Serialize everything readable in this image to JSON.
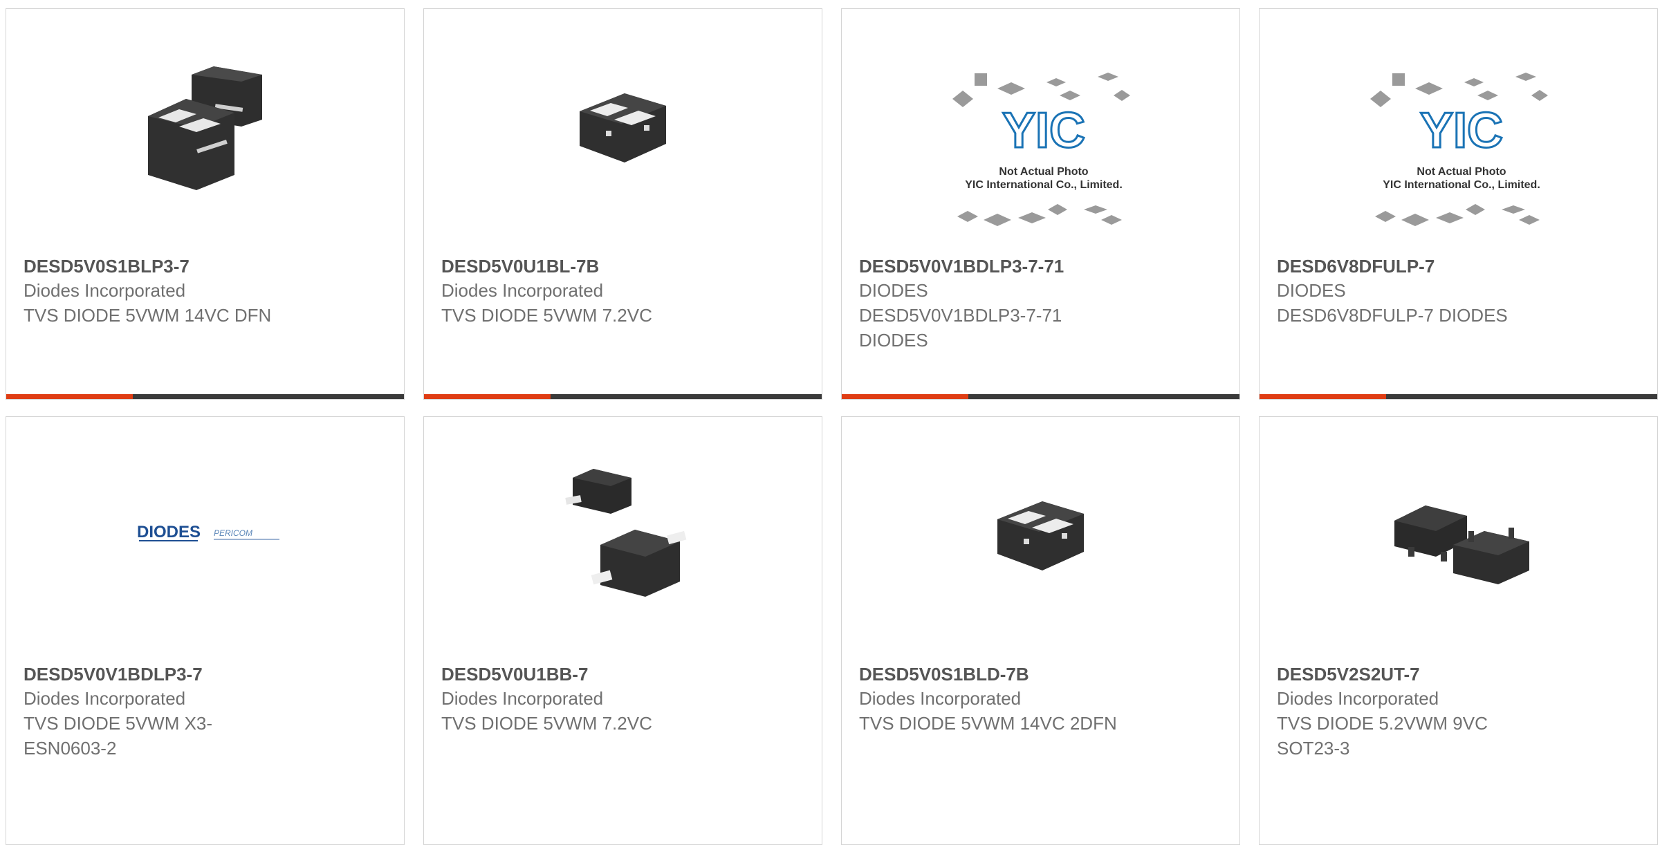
{
  "colors": {
    "accent_red": "#df3d14",
    "accent_dark": "#3a3a3a",
    "text_dark": "#555555",
    "text_mid": "#707070",
    "card_border": "#d4d4d4",
    "yic_blue": "#1a73b5",
    "diodes_blue": "#1e4f93"
  },
  "products": [
    {
      "part_number": "DESD5V0S1BLP3-7",
      "lines": [
        "Diodes Incorporated",
        "TVS DIODE 5VWM 14VC DFN"
      ],
      "image": "dfn-two-packages-icon"
    },
    {
      "part_number": "DESD5V0U1BL-7B",
      "lines": [
        "Diodes Incorporated",
        "TVS DIODE 5VWM 7.2VC"
      ],
      "image": "dfn-package-icon"
    },
    {
      "part_number": "DESD5V0V1BDLP3-7-71",
      "lines": [
        "DIODES",
        "DESD5V0V1BDLP3-7-71",
        "DIODES"
      ],
      "image": "yic-placeholder-icon",
      "placeholder_caption": [
        "Not Actual Photo",
        "YIC International Co., Limited."
      ],
      "placeholder_logo": "YIC"
    },
    {
      "part_number": "DESD6V8DFULP-7",
      "lines": [
        "DIODES",
        "DESD6V8DFULP-7 DIODES"
      ],
      "image": "yic-placeholder-icon",
      "placeholder_caption": [
        "Not Actual Photo",
        "YIC International Co., Limited."
      ],
      "placeholder_logo": "YIC"
    },
    {
      "part_number": "DESD5V0V1BDLP3-7",
      "lines": [
        "Diodes Incorporated",
        "TVS DIODE 5VWM X3-",
        "ESN0603-2"
      ],
      "image": "diodes-logo-icon",
      "logo_text": "DIODES",
      "logo_text2": "PERICOM"
    },
    {
      "part_number": "DESD5V0U1BB-7",
      "lines": [
        "Diodes Incorporated",
        "TVS DIODE 5VWM 7.2VC"
      ],
      "image": "sod-packages-icon"
    },
    {
      "part_number": "DESD5V0S1BLD-7B",
      "lines": [
        "Diodes Incorporated",
        "TVS DIODE 5VWM 14VC 2DFN"
      ],
      "image": "dfn-package-icon"
    },
    {
      "part_number": "DESD5V2S2UT-7",
      "lines": [
        "Diodes Incorporated",
        "TVS DIODE 5.2VWM 9VC",
        "SOT23-3"
      ],
      "image": "sot23-packages-icon"
    }
  ]
}
